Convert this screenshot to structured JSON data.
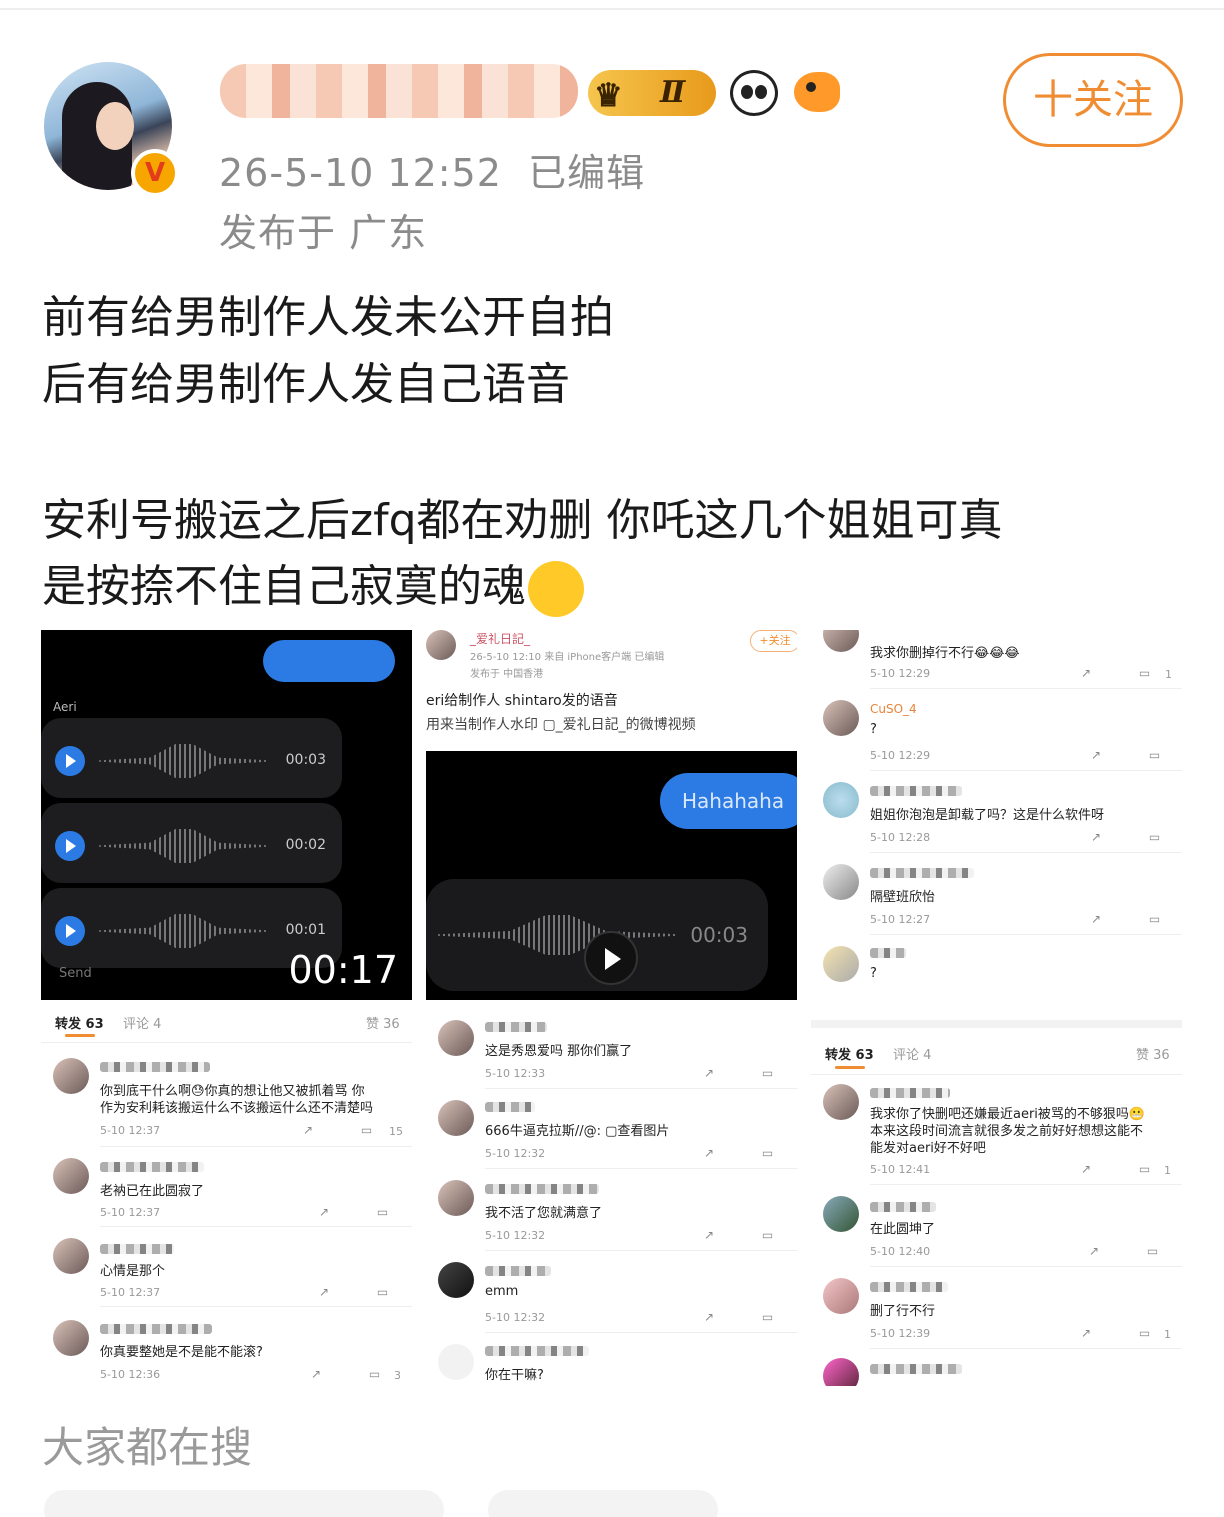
{
  "author": {
    "avatar_alt": "user-avatar",
    "verified_mark": "V",
    "level_badge": "Ⅱ",
    "time": "26-5-10 12:52",
    "edited": "已编辑",
    "location": "发布于 广东",
    "follow_label": "十关注"
  },
  "post": {
    "line1": "前有给男制作人发未公开自拍",
    "line2": "后有给男制作人发自己语音",
    "line3": "安利号搬运之后zfq都在劝删 你吒这几个姐姐可真",
    "line4": "是按捺不住自己寂寞的魂"
  },
  "images": {
    "img1": {
      "sender": "Aeri",
      "durations": [
        "00:03",
        "00:02",
        "00:01"
      ],
      "send_label": "Send",
      "video_length": "00:17"
    },
    "img2": {
      "user": "_爱礼日記_",
      "meta": "26-5-10 12:10  来自 iPhone客户端  已编辑",
      "location": "发布于 中国香港",
      "follow": "+关注",
      "text1": "eri给制作人 shintaro发的语音",
      "text2": "用来当制作人水印 ▢_爱礼日記_的微博视频",
      "bubble": "Hahahaha",
      "duration": "00:03"
    },
    "img3": {
      "comments": [
        {
          "text": "我求你删掉行不行😂😂😂",
          "time": "5-10 12:29",
          "likes": "1"
        },
        {
          "name": "CuSO_4",
          "text": "?",
          "time": "5-10 12:29",
          "likes": ""
        },
        {
          "text": "姐姐你泡泡是卸载了吗？这是什么软件呀",
          "time": "5-10 12:28",
          "likes": ""
        },
        {
          "text": "隔壁班欣怡",
          "time": "5-10 12:27",
          "likes": ""
        },
        {
          "text": "?",
          "time": "",
          "likes": ""
        }
      ]
    },
    "img4": {
      "tabs": {
        "reposts": "转发 63",
        "comments": "评论 4",
        "likes": "赞 36"
      },
      "comments": [
        {
          "text1": "你到底干什么啊😓你真的想让他又被抓着骂 你",
          "text2": "作为安利耗该搬运什么不该搬运什么还不清楚吗",
          "time": "5-10 12:37",
          "likes": "15"
        },
        {
          "text1": "老衲已在此圆寂了",
          "text2": "",
          "time": "5-10 12:37",
          "likes": ""
        },
        {
          "text1": "心情是那个",
          "text2": "",
          "time": "5-10 12:37",
          "likes": ""
        },
        {
          "text1": "你真要整她是不是能不能滚?",
          "text2": "",
          "time": "5-10 12:36",
          "likes": "3"
        }
      ]
    },
    "img5": {
      "comments": [
        {
          "text": "这是秀恩爱吗 那你们赢了",
          "time": "5-10 12:33"
        },
        {
          "text": "666牛逼克拉斯//@: ▢查看图片",
          "time": "5-10 12:32"
        },
        {
          "text": "我不活了您就满意了",
          "time": "5-10 12:32"
        },
        {
          "text": "emm",
          "time": "5-10 12:32"
        },
        {
          "text": "你在干嘛?",
          "time": ""
        }
      ]
    },
    "img6": {
      "tabs": {
        "reposts": "转发 63",
        "comments": "评论 4",
        "likes": "赞 36"
      },
      "comments": [
        {
          "text1": "我求你了快删吧还嫌最近aeri被骂的不够狠吗😬",
          "text2": "本来这段时间流言就很多发之前好好想想这能不",
          "text3": "能发对aeri好不好吧",
          "time": "5-10 12:41",
          "likes": "1"
        },
        {
          "text1": "在此圆坤了",
          "text2": "",
          "text3": "",
          "time": "5-10 12:40",
          "likes": ""
        },
        {
          "text1": "删了行不行",
          "text2": "",
          "text3": "",
          "time": "5-10 12:39",
          "likes": "1"
        }
      ]
    }
  },
  "section": {
    "title": "大家都在搜"
  },
  "colors": {
    "accent": "#f08d33",
    "link_blue": "#2c7be5",
    "meta_gray": "#8b8b8b"
  }
}
